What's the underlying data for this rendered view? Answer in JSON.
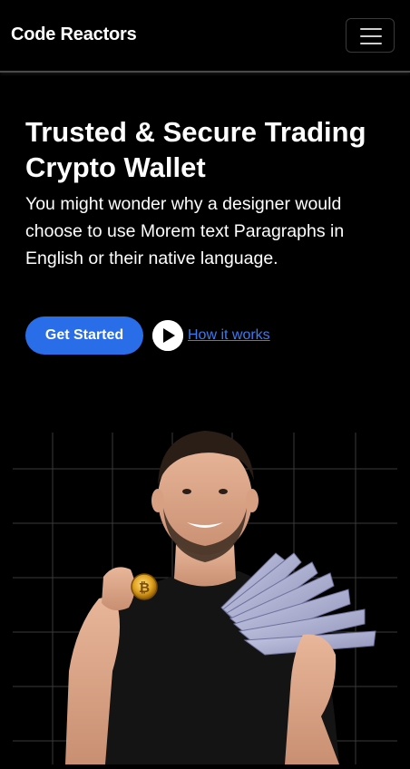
{
  "navbar": {
    "brand": "Code Reactors",
    "menu_icon": "hamburger-menu-icon"
  },
  "hero": {
    "title": "Trusted & Secure Trading Crypto Wallet",
    "description": "You might wonder why a designer would choose to use Morem text Paragraphs in English or their native language.",
    "cta_label": "Get Started",
    "secondary_link": "How it works",
    "play_icon": "play-icon"
  },
  "colors": {
    "background": "#000000",
    "accent": "#2a6de8",
    "link": "#3a7bf0",
    "text": "#ffffff"
  },
  "image": {
    "description_icon": "person-holding-bitcoin-and-cash-illustration"
  }
}
